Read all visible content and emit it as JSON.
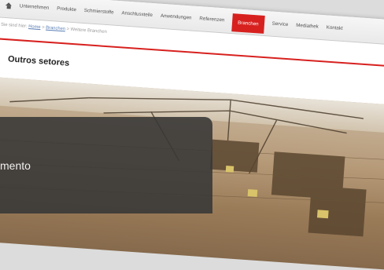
{
  "nav": {
    "items": [
      "Unternehmen",
      "Produkte",
      "Schmierstoffe",
      "Anschlussteile",
      "Anwendungen",
      "Referenzen",
      "Branchen",
      "Service",
      "Mediathek",
      "Kontakt"
    ],
    "active": "Branchen"
  },
  "breadcrumb": {
    "prefix": "Sie sind hier:",
    "home": "Home",
    "sep1": ">",
    "branchen": "Branchen",
    "sep2": ">",
    "current": "Weitere Branchen"
  },
  "section": {
    "heading": "Outros setores"
  },
  "overlay": {
    "text": "mento"
  },
  "colors": {
    "accent": "#d7211f"
  }
}
